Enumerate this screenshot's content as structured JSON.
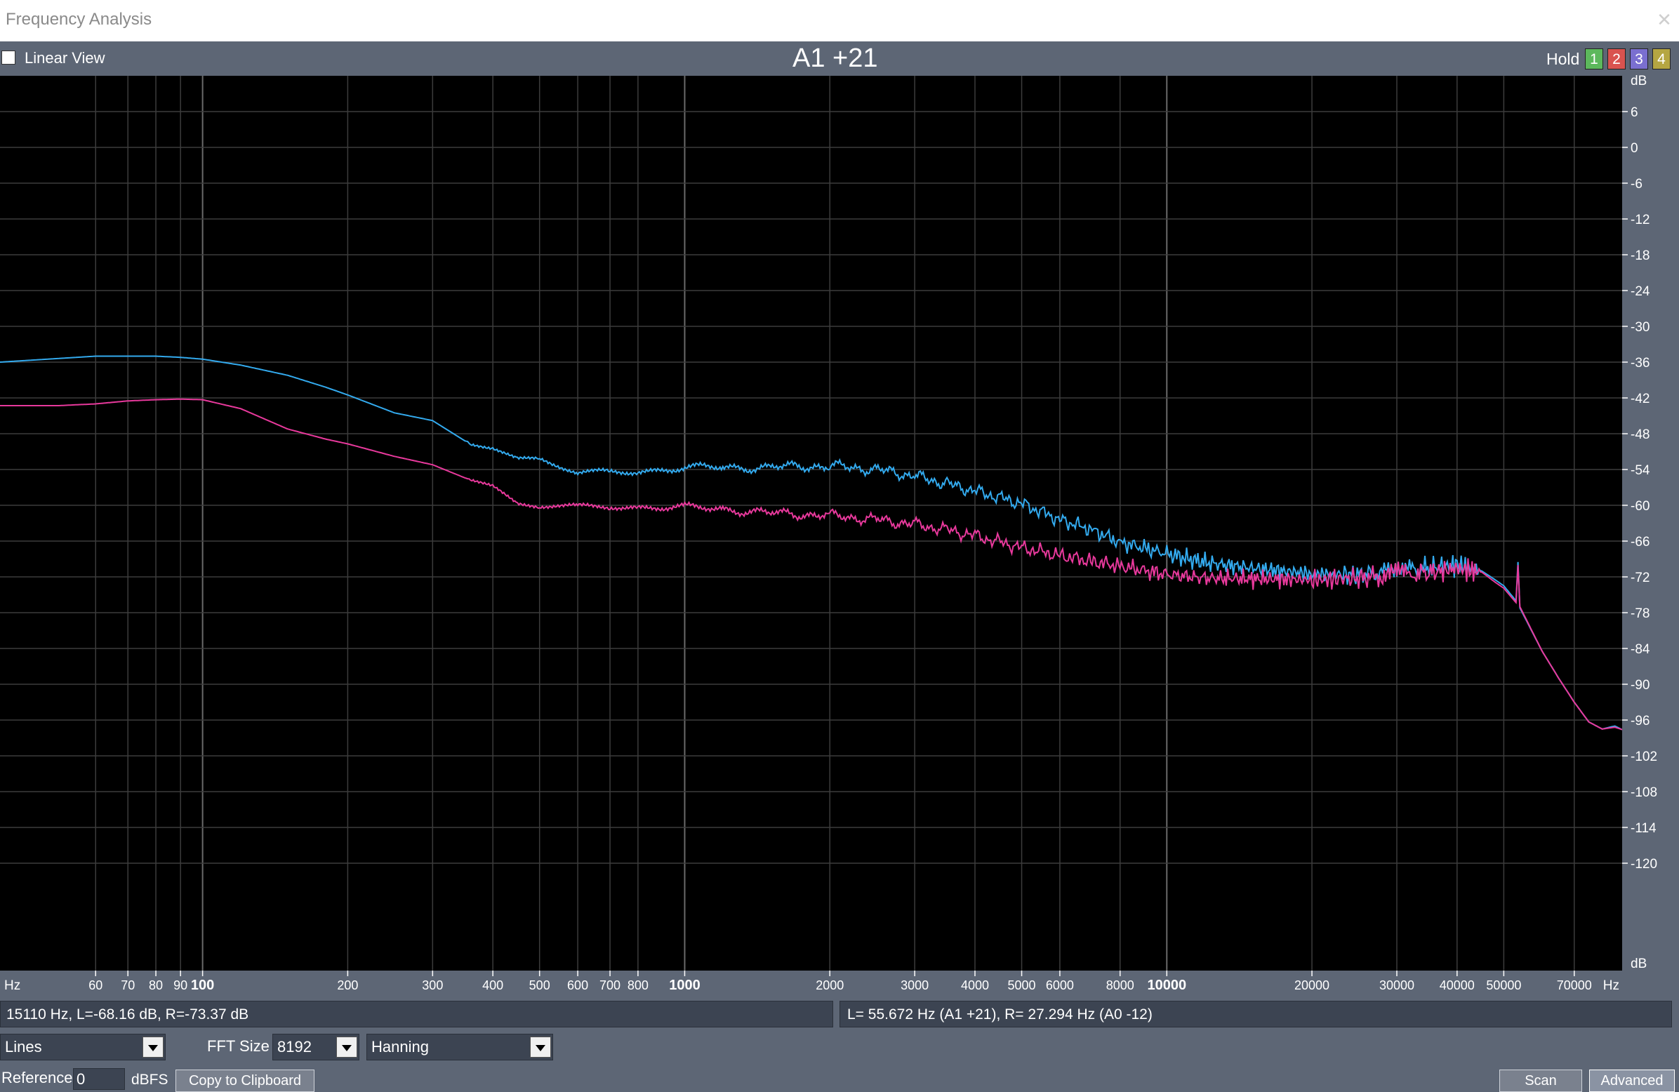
{
  "window": {
    "title": "Frequency Analysis"
  },
  "toolbar": {
    "linear_view_label": "Linear View",
    "linear_view_checked": false,
    "chart_title": "A1 +21",
    "hold_label": "Hold",
    "hold_buttons": [
      {
        "label": "1",
        "color": "#5cb85c"
      },
      {
        "label": "2",
        "color": "#d9534f"
      },
      {
        "label": "3",
        "color": "#7a6fd0"
      },
      {
        "label": "4",
        "color": "#b5a642"
      }
    ]
  },
  "chart_data": {
    "type": "line",
    "x_scale": "log",
    "xlim": [
      38,
      88000
    ],
    "ylim": [
      -138,
      12
    ],
    "x_unit_label": "Hz",
    "y_unit_label": "dB",
    "x_ticks": [
      {
        "value": 60,
        "label": "60"
      },
      {
        "value": 70,
        "label": "70"
      },
      {
        "value": 80,
        "label": "80"
      },
      {
        "value": 90,
        "label": "90"
      },
      {
        "value": 100,
        "label": "100",
        "major": true
      },
      {
        "value": 200,
        "label": "200"
      },
      {
        "value": 300,
        "label": "300"
      },
      {
        "value": 400,
        "label": "400"
      },
      {
        "value": 500,
        "label": "500"
      },
      {
        "value": 600,
        "label": "600"
      },
      {
        "value": 700,
        "label": "700"
      },
      {
        "value": 800,
        "label": "800"
      },
      {
        "value": 1000,
        "label": "1000",
        "major": true
      },
      {
        "value": 2000,
        "label": "2000"
      },
      {
        "value": 3000,
        "label": "3000"
      },
      {
        "value": 4000,
        "label": "4000"
      },
      {
        "value": 5000,
        "label": "5000"
      },
      {
        "value": 6000,
        "label": "6000"
      },
      {
        "value": 8000,
        "label": "8000"
      },
      {
        "value": 10000,
        "label": "10000",
        "major": true
      },
      {
        "value": 20000,
        "label": "20000"
      },
      {
        "value": 30000,
        "label": "30000"
      },
      {
        "value": 40000,
        "label": "40000"
      },
      {
        "value": 50000,
        "label": "50000"
      },
      {
        "value": 70000,
        "label": "70000"
      }
    ],
    "y_ticks": [
      6,
      0,
      -6,
      -12,
      -18,
      -24,
      -30,
      -36,
      -42,
      -48,
      -54,
      -60,
      -66,
      -72,
      -78,
      -84,
      -90,
      -96,
      -102,
      -108,
      -114,
      -120
    ],
    "grid": true,
    "series": [
      {
        "color": "#33aaee",
        "x": [
          38,
          50,
          60,
          70,
          80,
          90,
          100,
          120,
          150,
          180,
          200,
          250,
          300,
          350,
          400,
          450,
          500,
          600,
          700,
          800,
          1000,
          1200,
          1500,
          2000,
          2500,
          3000,
          3500,
          4000,
          5000,
          6000,
          7000,
          8000,
          10000,
          12000,
          15000,
          20000,
          25000,
          30000,
          35000,
          40000,
          45000,
          48000,
          50000,
          53000,
          53500,
          54000,
          60000,
          65000,
          70000,
          75000,
          80000,
          85000,
          88000
        ],
        "y": [
          -36,
          -35.4,
          -35,
          -35,
          -35,
          -35.2,
          -35.5,
          -36.5,
          -38.2,
          -40.2,
          -41.5,
          -44.5,
          -45.8,
          -49.2,
          -50.3,
          -52.2,
          -52.2,
          -54.8,
          -54.4,
          -54.3,
          -53.7,
          -53.7,
          -53.6,
          -53.4,
          -54,
          -55.1,
          -56.4,
          -57.6,
          -59.7,
          -62.4,
          -64.1,
          -66.2,
          -68.1,
          -69.6,
          -70.5,
          -71.5,
          -71.6,
          -71.1,
          -70.5,
          -70.0,
          -71.0,
          -72.5,
          -73.5,
          -76,
          -69.5,
          -77.2,
          -84.4,
          -89,
          -93,
          -96.3,
          -97.5,
          -97.0,
          -97.6
        ]
      },
      {
        "color": "#e8399c",
        "x": [
          38,
          50,
          60,
          70,
          80,
          90,
          100,
          120,
          150,
          180,
          200,
          250,
          300,
          350,
          400,
          450,
          500,
          600,
          700,
          800,
          1000,
          1200,
          1500,
          2000,
          2500,
          3000,
          3500,
          4000,
          5000,
          6000,
          7000,
          8000,
          10000,
          12000,
          15000,
          20000,
          25000,
          30000,
          35000,
          40000,
          45000,
          48000,
          50000,
          53000,
          53500,
          54000,
          60000,
          65000,
          70000,
          75000,
          80000,
          85000,
          88000
        ],
        "y": [
          -43.3,
          -43.3,
          -43,
          -42.5,
          -42.3,
          -42.2,
          -42.3,
          -43.8,
          -47.2,
          -48.9,
          -49.7,
          -51.8,
          -53.2,
          -55.4,
          -56.9,
          -59.8,
          -60.3,
          -60.3,
          -60.1,
          -60.3,
          -60.4,
          -60.6,
          -61.3,
          -61.7,
          -62.4,
          -63.2,
          -64.1,
          -65.1,
          -67.1,
          -68.4,
          -69.4,
          -70.2,
          -71.6,
          -72.2,
          -72.3,
          -72.5,
          -72.2,
          -71.6,
          -71.3,
          -70.6,
          -71.2,
          -72.9,
          -73.9,
          -76.3,
          -70.0,
          -77.0,
          -84.4,
          -89,
          -93,
          -96.3,
          -97.5,
          -97.2,
          -97.6
        ]
      }
    ]
  },
  "status": {
    "cursor_readout": "15110 Hz, L=-68.16 dB, R=-73.37 dB",
    "peak_readout": "L= 55.672 Hz (A1 +21), R= 27.294 Hz (A0 -12)"
  },
  "controls": {
    "display_mode": "Lines",
    "fft_size_label": "FFT Size",
    "fft_size": "8192",
    "window_func": "Hanning",
    "reference_label": "Reference",
    "reference_value": "0",
    "reference_unit": "dBFS",
    "copy_button": "Copy to Clipboard",
    "scan_button": "Scan",
    "advanced_button": "Advanced"
  }
}
